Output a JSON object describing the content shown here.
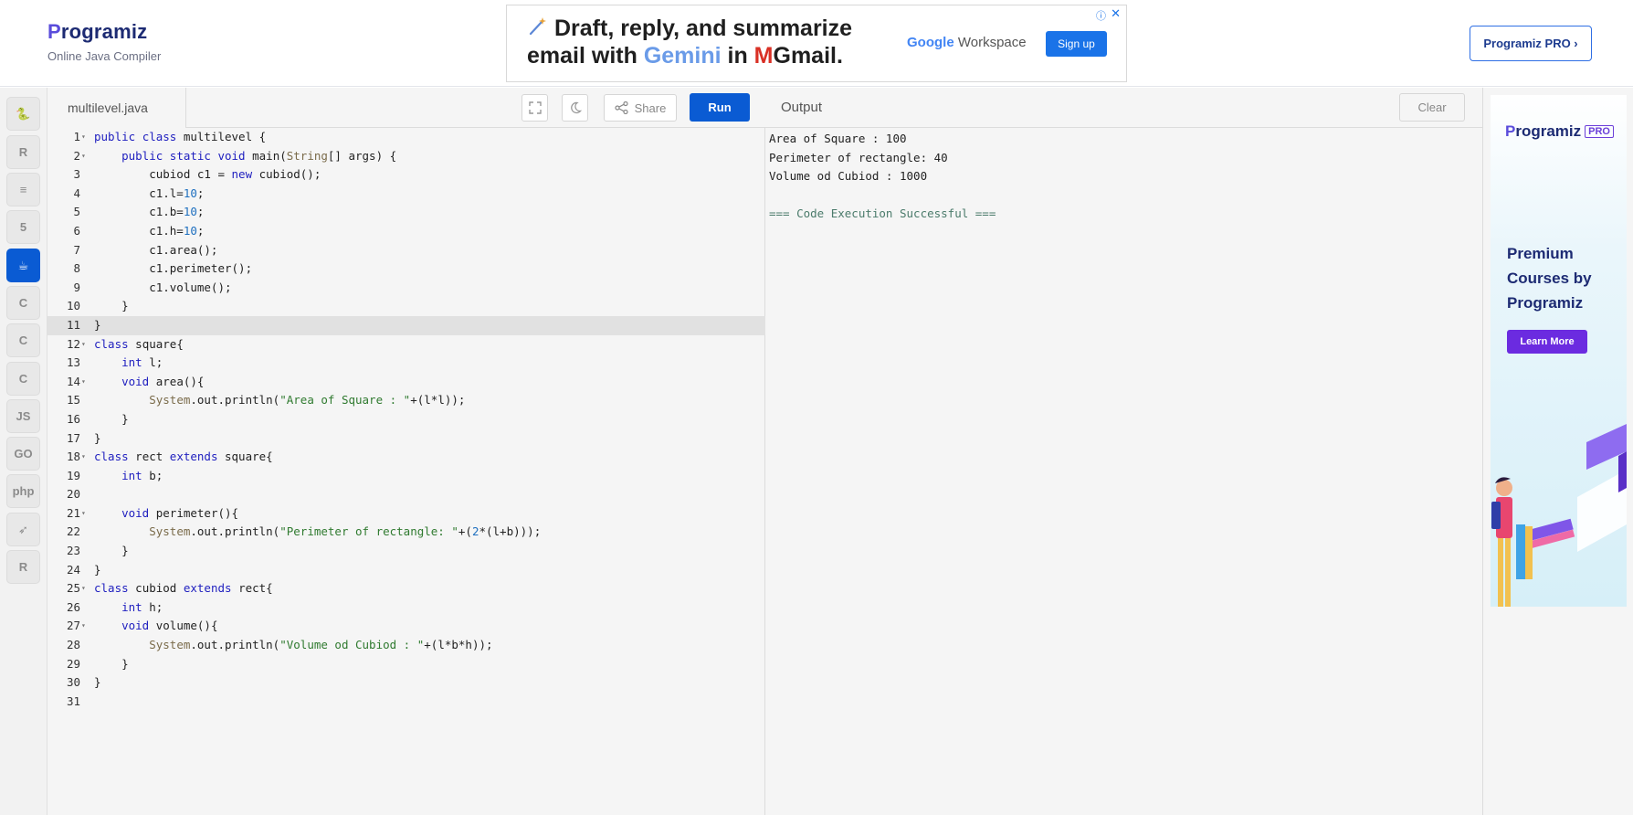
{
  "header": {
    "brand_prefix": "P",
    "brand_rest": "rogramiz",
    "subtitle": "Online Java Compiler",
    "pro_button": "Programiz PRO ›"
  },
  "ad_banner": {
    "line1": "Draft, reply, and summarize",
    "line2_a": "email with ",
    "line2_gemini": "Gemini",
    "line2_b": " in ",
    "line2_m": "M",
    "line2_gmail": "Gmail.",
    "workspace_google": "Google",
    "workspace_label": " Workspace",
    "signup": "Sign up",
    "info_icon": "ⓘ",
    "close_icon": "✕"
  },
  "rail": {
    "items": [
      {
        "name": "python",
        "glyph": "🐍"
      },
      {
        "name": "r",
        "glyph": "R"
      },
      {
        "name": "sql",
        "glyph": "≡"
      },
      {
        "name": "html",
        "glyph": "5"
      },
      {
        "name": "java",
        "glyph": "☕"
      },
      {
        "name": "c",
        "glyph": "C"
      },
      {
        "name": "cpp",
        "glyph": "C"
      },
      {
        "name": "csharp",
        "glyph": "C"
      },
      {
        "name": "js",
        "glyph": "JS"
      },
      {
        "name": "go",
        "glyph": "GO"
      },
      {
        "name": "php",
        "glyph": "php"
      },
      {
        "name": "swift",
        "glyph": "➶"
      },
      {
        "name": "rust",
        "glyph": "R"
      }
    ],
    "active": 4
  },
  "editor": {
    "file_name": "multilevel.java",
    "share": "Share",
    "run": "Run",
    "highlight_line": 11,
    "fold_lines": [
      1,
      2,
      12,
      14,
      18,
      21,
      25,
      27
    ],
    "lines": [
      "public class multilevel {",
      "    public static void main(String[] args) {",
      "        cubiod c1 = new cubiod();",
      "        c1.l=10;",
      "        c1.b=10;",
      "        c1.h=10;",
      "        c1.area();",
      "        c1.perimeter();",
      "        c1.volume();",
      "    }",
      "}",
      "class square{",
      "    int l;",
      "    void area(){",
      "        System.out.println(\"Area of Square : \"+(l*l));",
      "    }",
      "}",
      "class rect extends square{",
      "    int b;",
      "",
      "    void perimeter(){",
      "        System.out.println(\"Perimeter of rectangle: \"+(2*(l+b)));",
      "    }",
      "}",
      "class cubiod extends rect{",
      "    int h;",
      "    void volume(){",
      "        System.out.println(\"Volume od Cubiod : \"+(l*b*h));",
      "    }",
      "}",
      ""
    ]
  },
  "output": {
    "title": "Output",
    "clear": "Clear",
    "lines": [
      "Area of Square : 100",
      "Perimeter of rectangle: 40",
      "Volume od Cubiod : 1000",
      "",
      "=== Code Execution Successful ==="
    ]
  },
  "side_ad": {
    "logo_prefix": "P",
    "logo_rest": "rogramiz",
    "logo_pro": "PRO",
    "headline": "Premium Courses by Programiz",
    "cta": "Learn More"
  },
  "colors": {
    "accent": "#0a5bd3",
    "keyword": "#1e1ebf",
    "string": "#2f7a2f",
    "success": "#4b7b6b"
  }
}
